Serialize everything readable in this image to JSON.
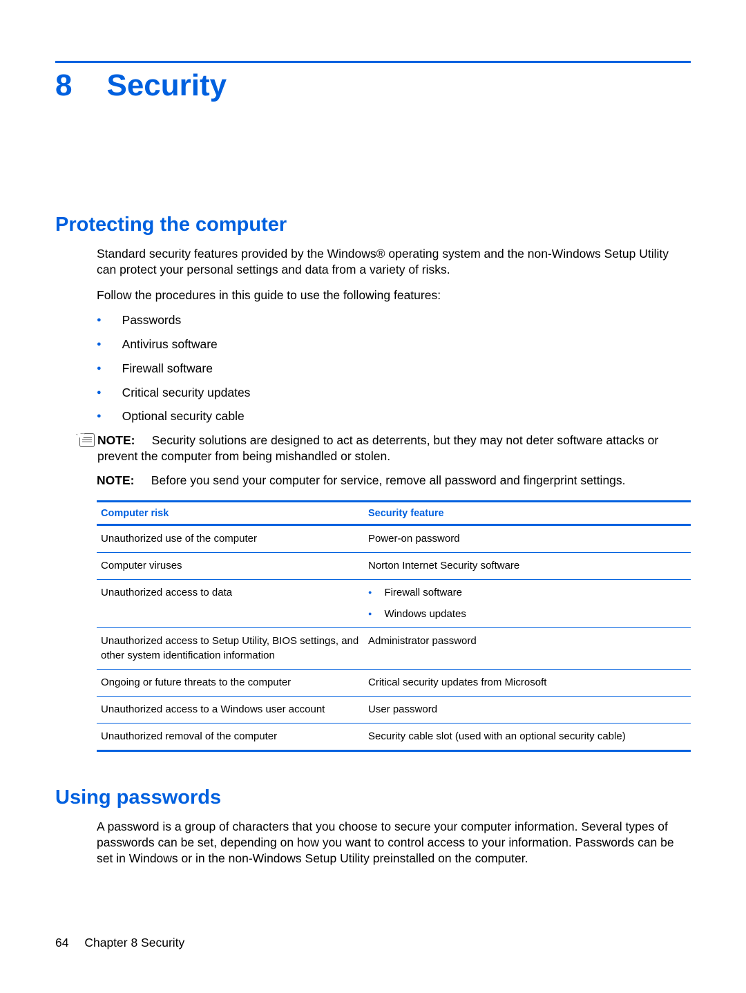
{
  "chapter": {
    "number": "8",
    "title": "Security"
  },
  "section1": {
    "title": "Protecting the computer",
    "para1": "Standard security features provided by the Windows® operating system and the non-Windows Setup Utility can protect your personal settings and data from a variety of risks.",
    "para2": "Follow the procedures in this guide to use the following features:",
    "features": [
      "Passwords",
      "Antivirus software",
      "Firewall software",
      "Critical security updates",
      "Optional security cable"
    ],
    "note1_label": "NOTE:",
    "note1_text": "Security solutions are designed to act as deterrents, but they may not deter software attacks or prevent the computer from being mishandled or stolen.",
    "note2_label": "NOTE:",
    "note2_text": "Before you send your computer for service, remove all password and fingerprint settings.",
    "table": {
      "header_risk": "Computer risk",
      "header_feature": "Security feature",
      "rows": [
        {
          "risk": "Unauthorized use of the computer",
          "feature": "Power-on password"
        },
        {
          "risk": "Computer viruses",
          "feature": "Norton Internet Security software"
        },
        {
          "risk": "Unauthorized access to data",
          "feature_list": [
            "Firewall software",
            "Windows updates"
          ]
        },
        {
          "risk": "Unauthorized access to Setup Utility, BIOS settings, and other system identification information",
          "feature": "Administrator password"
        },
        {
          "risk": "Ongoing or future threats to the computer",
          "feature": "Critical security updates from Microsoft"
        },
        {
          "risk": "Unauthorized access to a Windows user account",
          "feature": "User password"
        },
        {
          "risk": "Unauthorized removal of the computer",
          "feature": "Security cable slot (used with an optional security cable)"
        }
      ]
    }
  },
  "section2": {
    "title": "Using passwords",
    "para1": "A password is a group of characters that you choose to secure your computer information. Several types of passwords can be set, depending on how you want to control access to your information. Passwords can be set in Windows or in the non-Windows Setup Utility preinstalled on the computer."
  },
  "footer": {
    "page_number": "64",
    "chapter_ref": "Chapter 8   Security"
  }
}
